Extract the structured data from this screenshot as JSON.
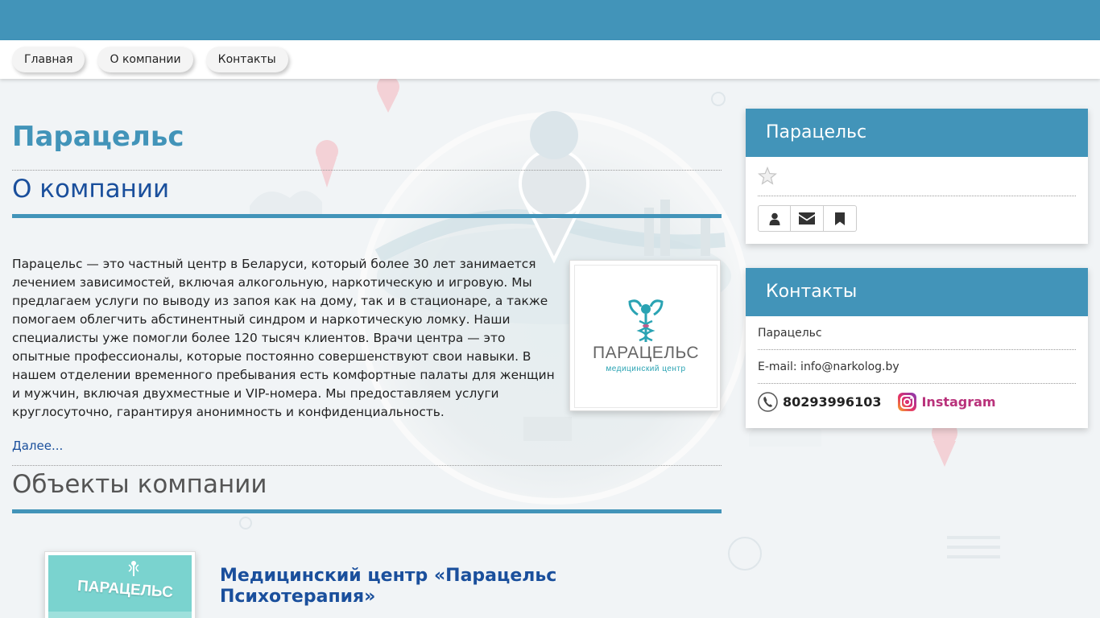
{
  "nav": {
    "items": [
      {
        "label": "Главная"
      },
      {
        "label": "О компании"
      },
      {
        "label": "Контакты"
      }
    ]
  },
  "main": {
    "company_name": "Парацельс",
    "about_heading": "О компании",
    "about_text": "Парацельс — это частный центр в Беларуси, который более 30 лет занимается лечением зависимостей, включая алкогольную, наркотическую и игровую. Мы предлагаем услуги по выводу из запоя как на дому, так и в стационаре, а также помогаем облегчить абстинентный синдром и наркотическую ломку. Наши специалисты уже помогли более 120 тысяч клиентов. Врачи центра — это опытные профессионалы, которые постоянно совершенствуют свои навыки. В нашем отделении временного пребывания есть комфортные палаты для женщин и мужчин, включая двухместные и VIP-номера. Мы предоставляем услуги круглосуточно, гарантируя анонимность и конфиденциальность.",
    "more_link": "Далее...",
    "logo": {
      "name": "ПАРАЦЕЛЬС",
      "subtitle": "медицинский центр"
    },
    "objects_heading": "Объекты компании",
    "objects": [
      {
        "title": "Медицинский центр «Парацельс Психотерапия»",
        "photo_sign": "ПАРАЦЕЛЬС"
      }
    ]
  },
  "sidebar": {
    "company_card": {
      "title": "Парацельс",
      "rating_icon": "star-outline-icon",
      "buttons": [
        "user-icon",
        "envelope-icon",
        "bookmark-icon"
      ]
    },
    "contacts_card": {
      "title": "Контакты",
      "name": "Парацельс",
      "email": "E-mail: info@narkolog.by",
      "phone": "80293996103",
      "instagram": "Instagram"
    }
  },
  "colors": {
    "primary": "#4294b9",
    "link": "#1a4f9c",
    "instagram": "#b9327b",
    "logo_teal": "#2aa3b3"
  }
}
